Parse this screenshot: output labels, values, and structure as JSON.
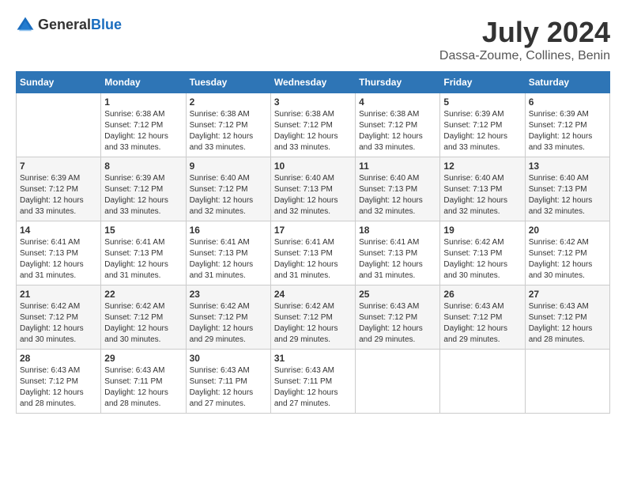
{
  "header": {
    "logo_general": "General",
    "logo_blue": "Blue",
    "title": "July 2024",
    "subtitle": "Dassa-Zoume, Collines, Benin"
  },
  "calendar": {
    "days_of_week": [
      "Sunday",
      "Monday",
      "Tuesday",
      "Wednesday",
      "Thursday",
      "Friday",
      "Saturday"
    ],
    "weeks": [
      [
        {
          "day": "",
          "info": ""
        },
        {
          "day": "1",
          "info": "Sunrise: 6:38 AM\nSunset: 7:12 PM\nDaylight: 12 hours\nand 33 minutes."
        },
        {
          "day": "2",
          "info": "Sunrise: 6:38 AM\nSunset: 7:12 PM\nDaylight: 12 hours\nand 33 minutes."
        },
        {
          "day": "3",
          "info": "Sunrise: 6:38 AM\nSunset: 7:12 PM\nDaylight: 12 hours\nand 33 minutes."
        },
        {
          "day": "4",
          "info": "Sunrise: 6:38 AM\nSunset: 7:12 PM\nDaylight: 12 hours\nand 33 minutes."
        },
        {
          "day": "5",
          "info": "Sunrise: 6:39 AM\nSunset: 7:12 PM\nDaylight: 12 hours\nand 33 minutes."
        },
        {
          "day": "6",
          "info": "Sunrise: 6:39 AM\nSunset: 7:12 PM\nDaylight: 12 hours\nand 33 minutes."
        }
      ],
      [
        {
          "day": "7",
          "info": "Sunrise: 6:39 AM\nSunset: 7:12 PM\nDaylight: 12 hours\nand 33 minutes."
        },
        {
          "day": "8",
          "info": "Sunrise: 6:39 AM\nSunset: 7:12 PM\nDaylight: 12 hours\nand 33 minutes."
        },
        {
          "day": "9",
          "info": "Sunrise: 6:40 AM\nSunset: 7:12 PM\nDaylight: 12 hours\nand 32 minutes."
        },
        {
          "day": "10",
          "info": "Sunrise: 6:40 AM\nSunset: 7:13 PM\nDaylight: 12 hours\nand 32 minutes."
        },
        {
          "day": "11",
          "info": "Sunrise: 6:40 AM\nSunset: 7:13 PM\nDaylight: 12 hours\nand 32 minutes."
        },
        {
          "day": "12",
          "info": "Sunrise: 6:40 AM\nSunset: 7:13 PM\nDaylight: 12 hours\nand 32 minutes."
        },
        {
          "day": "13",
          "info": "Sunrise: 6:40 AM\nSunset: 7:13 PM\nDaylight: 12 hours\nand 32 minutes."
        }
      ],
      [
        {
          "day": "14",
          "info": "Sunrise: 6:41 AM\nSunset: 7:13 PM\nDaylight: 12 hours\nand 31 minutes."
        },
        {
          "day": "15",
          "info": "Sunrise: 6:41 AM\nSunset: 7:13 PM\nDaylight: 12 hours\nand 31 minutes."
        },
        {
          "day": "16",
          "info": "Sunrise: 6:41 AM\nSunset: 7:13 PM\nDaylight: 12 hours\nand 31 minutes."
        },
        {
          "day": "17",
          "info": "Sunrise: 6:41 AM\nSunset: 7:13 PM\nDaylight: 12 hours\nand 31 minutes."
        },
        {
          "day": "18",
          "info": "Sunrise: 6:41 AM\nSunset: 7:13 PM\nDaylight: 12 hours\nand 31 minutes."
        },
        {
          "day": "19",
          "info": "Sunrise: 6:42 AM\nSunset: 7:13 PM\nDaylight: 12 hours\nand 30 minutes."
        },
        {
          "day": "20",
          "info": "Sunrise: 6:42 AM\nSunset: 7:12 PM\nDaylight: 12 hours\nand 30 minutes."
        }
      ],
      [
        {
          "day": "21",
          "info": "Sunrise: 6:42 AM\nSunset: 7:12 PM\nDaylight: 12 hours\nand 30 minutes."
        },
        {
          "day": "22",
          "info": "Sunrise: 6:42 AM\nSunset: 7:12 PM\nDaylight: 12 hours\nand 30 minutes."
        },
        {
          "day": "23",
          "info": "Sunrise: 6:42 AM\nSunset: 7:12 PM\nDaylight: 12 hours\nand 29 minutes."
        },
        {
          "day": "24",
          "info": "Sunrise: 6:42 AM\nSunset: 7:12 PM\nDaylight: 12 hours\nand 29 minutes."
        },
        {
          "day": "25",
          "info": "Sunrise: 6:43 AM\nSunset: 7:12 PM\nDaylight: 12 hours\nand 29 minutes."
        },
        {
          "day": "26",
          "info": "Sunrise: 6:43 AM\nSunset: 7:12 PM\nDaylight: 12 hours\nand 29 minutes."
        },
        {
          "day": "27",
          "info": "Sunrise: 6:43 AM\nSunset: 7:12 PM\nDaylight: 12 hours\nand 28 minutes."
        }
      ],
      [
        {
          "day": "28",
          "info": "Sunrise: 6:43 AM\nSunset: 7:12 PM\nDaylight: 12 hours\nand 28 minutes."
        },
        {
          "day": "29",
          "info": "Sunrise: 6:43 AM\nSunset: 7:11 PM\nDaylight: 12 hours\nand 28 minutes."
        },
        {
          "day": "30",
          "info": "Sunrise: 6:43 AM\nSunset: 7:11 PM\nDaylight: 12 hours\nand 27 minutes."
        },
        {
          "day": "31",
          "info": "Sunrise: 6:43 AM\nSunset: 7:11 PM\nDaylight: 12 hours\nand 27 minutes."
        },
        {
          "day": "",
          "info": ""
        },
        {
          "day": "",
          "info": ""
        },
        {
          "day": "",
          "info": ""
        }
      ]
    ]
  }
}
